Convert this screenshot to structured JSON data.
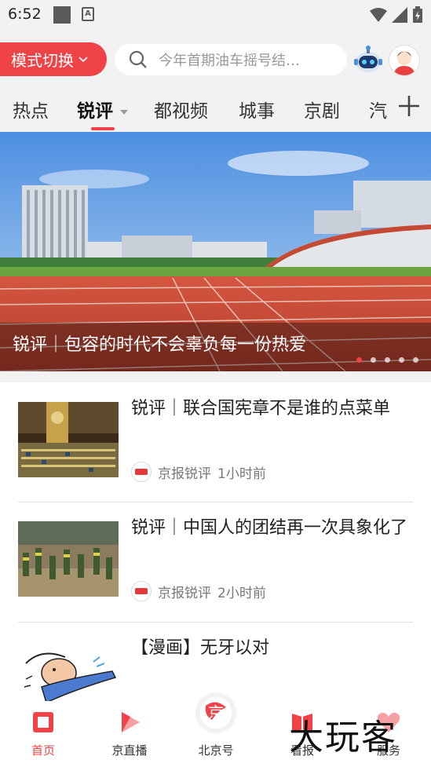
{
  "status_bar": {
    "time": "6:52"
  },
  "header": {
    "mode_button": "模式切换",
    "search_placeholder": "今年首期油车摇号结…"
  },
  "tabs": [
    {
      "label": "热点"
    },
    {
      "label": "锐评",
      "active": true
    },
    {
      "label": "都视频"
    },
    {
      "label": "城事"
    },
    {
      "label": "京剧"
    },
    {
      "label": "汽"
    }
  ],
  "banner": {
    "title": "锐评｜包容的时代不会辜负每一份热爱",
    "slide_count": 5,
    "active_slide": 1
  },
  "news": [
    {
      "title": "锐评｜联合国宪章不是谁的点菜单",
      "source": "京报锐评",
      "time": "1小时前"
    },
    {
      "title": "锐评｜中国人的团结再一次具象化了",
      "source": "京报锐评",
      "time": "2小时前"
    },
    {
      "title": "【漫画】无牙以对"
    }
  ],
  "bottom_nav": [
    {
      "label": "首页",
      "active": true
    },
    {
      "label": "京直播"
    },
    {
      "label": "北京号"
    },
    {
      "label": "看报"
    },
    {
      "label": "服务"
    }
  ],
  "watermark": "大玩客",
  "colors": {
    "accent": "#f04347",
    "header_bg": "#f2f2f2"
  }
}
